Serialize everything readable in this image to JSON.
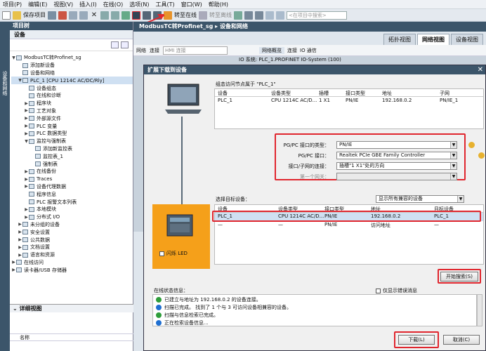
{
  "menu": [
    "项目(P)",
    "编辑(E)",
    "视图(V)",
    "插入(I)",
    "在线(O)",
    "选项(N)",
    "工具(T)",
    "窗口(W)",
    "帮助(H)"
  ],
  "toolbar": {
    "save_label": "保存项目",
    "go_online": "转至在线",
    "go_offline": "转至离线",
    "search_placeholder": "<在项目中搜索>"
  },
  "project_tree": {
    "title": "项目树",
    "devices_tab": "设备",
    "sidebar_label": "设备和网络",
    "items": [
      {
        "indent": 0,
        "label": "ModbusTC转Profinet_sg",
        "tri": "▼"
      },
      {
        "indent": 1,
        "label": "添加新设备",
        "tri": ""
      },
      {
        "indent": 1,
        "label": "设备和网络",
        "tri": ""
      },
      {
        "indent": 1,
        "label": "PLC_1 [CPU 1214C AC/DC/Rly]",
        "tri": "▼",
        "sel": true
      },
      {
        "indent": 2,
        "label": "设备组态",
        "tri": ""
      },
      {
        "indent": 2,
        "label": "在线和诊断",
        "tri": ""
      },
      {
        "indent": 2,
        "label": "程序块",
        "tri": "▶"
      },
      {
        "indent": 2,
        "label": "工艺对象",
        "tri": "▶"
      },
      {
        "indent": 2,
        "label": "外部源文件",
        "tri": "▶"
      },
      {
        "indent": 2,
        "label": "PLC 变量",
        "tri": "▶"
      },
      {
        "indent": 2,
        "label": "PLC 数据类型",
        "tri": "▶"
      },
      {
        "indent": 2,
        "label": "监控与强制表",
        "tri": "▼"
      },
      {
        "indent": 3,
        "label": "添加新监控表",
        "tri": ""
      },
      {
        "indent": 3,
        "label": "监控表_1",
        "tri": ""
      },
      {
        "indent": 3,
        "label": "强制表",
        "tri": ""
      },
      {
        "indent": 2,
        "label": "在线备份",
        "tri": "▶"
      },
      {
        "indent": 2,
        "label": "Traces",
        "tri": "▶"
      },
      {
        "indent": 2,
        "label": "设备代理数据",
        "tri": "▶"
      },
      {
        "indent": 2,
        "label": "程序信息",
        "tri": ""
      },
      {
        "indent": 2,
        "label": "PLC 报警文本列表",
        "tri": ""
      },
      {
        "indent": 2,
        "label": "本地模块",
        "tri": "▶"
      },
      {
        "indent": 2,
        "label": "分布式 I/O",
        "tri": "▶"
      },
      {
        "indent": 1,
        "label": "未分组的设备",
        "tri": "▶"
      },
      {
        "indent": 1,
        "label": "安全设置",
        "tri": "▶"
      },
      {
        "indent": 1,
        "label": "公共数据",
        "tri": "▶"
      },
      {
        "indent": 1,
        "label": "文档设置",
        "tri": "▶"
      },
      {
        "indent": 1,
        "label": "语言和资源",
        "tri": "▶"
      },
      {
        "indent": 0,
        "label": "在线访问",
        "tri": "▶"
      },
      {
        "indent": 0,
        "label": "读卡器/USB 存储器",
        "tri": "▶"
      }
    ],
    "detail_title": "详细视图",
    "name_col": "名称"
  },
  "editor": {
    "breadcrumb": "ModbusTC转Profinet_sg ▸ 设备和网络",
    "tabs": [
      "拓扑视图",
      "网络视图",
      "设备视图"
    ],
    "network_btn": "网络",
    "connect_btn": "连接",
    "hmi_combo": "HMI 连接",
    "io_system": "IO 系统: PLC_1.PROFINET IO-System (100)",
    "overview_tabs": [
      "网络概览",
      "连接",
      "IO 通信"
    ]
  },
  "dialog": {
    "title": "扩展下载到设备",
    "configured_title": "组态访问节点属于 \"PLC_1\"",
    "cfg_headers": [
      "设备",
      "设备类型",
      "插槽",
      "接口类型",
      "地址",
      "子网"
    ],
    "cfg_row": [
      "PLC_1",
      "CPU 1214C AC/D...",
      "1 X1",
      "PN/IE",
      "192.168.0.2",
      "PN/IE_1"
    ],
    "pgpc_type_label": "PG/PC 接口的类型：",
    "pgpc_type_value": "PN/IE",
    "pgpc_iface_label": "PG/PC 接口：",
    "pgpc_iface_value": "Realtek PCIe GBE Family Controller",
    "subnet_label": "接口/子网的连接：",
    "subnet_value": "插槽\"1 X1\"处的方向",
    "gateway_label": "第一个网关：",
    "target_label": "选择目标设备：",
    "filter_value": "显示所有兼容的设备",
    "tgt_headers": [
      "设备",
      "设备类型",
      "接口类型",
      "地址",
      "目标设备"
    ],
    "tgt_rows": [
      [
        "PLC_1",
        "CPU 1214C AC/D...",
        "PN/IE",
        "192.168.0.2",
        "PLC_1"
      ],
      [
        "—",
        "—",
        "PN/IE",
        "访问地址",
        "—"
      ]
    ],
    "flash_led": "闪烁 LED",
    "start_search": "开始搜索(S)",
    "status_label": "在线状态信息：",
    "only_errors": "仅显示错误消息",
    "status_msgs": [
      {
        "text": "已建立与地址为 192.168.0.2 的设备连接。",
        "color": "#2e9d3a"
      },
      {
        "text": "扫描已完成。 找到了 1 个与 3 可访问设备相兼容的设备。",
        "color": "#1f6fd1"
      },
      {
        "text": "扫描与信息检索已完成。",
        "color": "#2e9d3a"
      },
      {
        "text": "正在检索设备信息...",
        "color": "#1f6fd1"
      }
    ],
    "download_btn": "下载(L)",
    "cancel_btn": "取消(C)"
  },
  "colors": {
    "header": "#3c556a",
    "highlight": "#e0262e",
    "device_bg": "#f5a01a"
  }
}
